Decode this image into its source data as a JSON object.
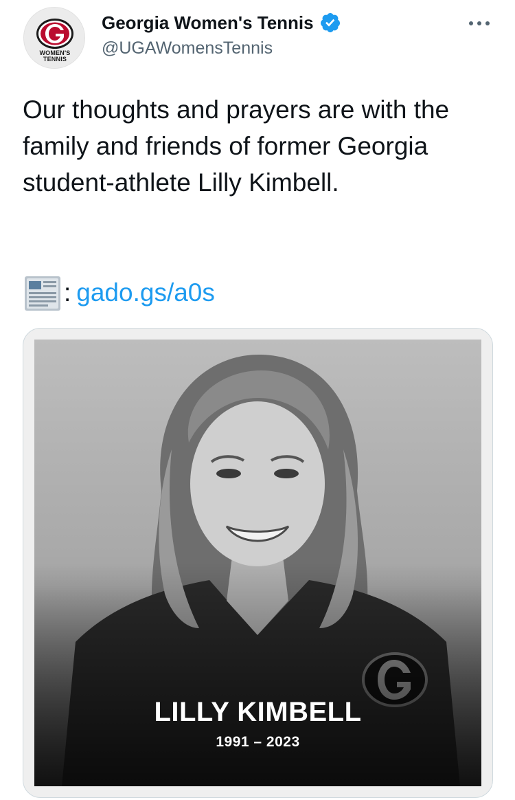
{
  "account": {
    "display_name": "Georgia Women's Tennis",
    "handle": "@UGAWomensTennis",
    "verified": true,
    "avatar_text": [
      "WOMEN'S",
      "TENNIS"
    ],
    "avatar_icon": "georgia-g-logo"
  },
  "tweet": {
    "text": "Our thoughts and prayers are with the family and friends of former Georgia student-athlete Lilly Kimbell.",
    "link_prefix_icon": "newspaper-emoji",
    "link_separator": ":",
    "link_text": "gado.gs/a0s"
  },
  "media": {
    "description_icon": "memorial-portrait-photo",
    "overlay_name": "LILLY KIMBELL",
    "overlay_years": "1991 – 2023"
  },
  "icons": {
    "more": "more-options-icon",
    "verified": "verified-badge-icon"
  },
  "colors": {
    "link": "#1d9bf0",
    "handle": "#536471",
    "verified": "#1d9bf0",
    "georgia_red": "#ba0c2f"
  }
}
